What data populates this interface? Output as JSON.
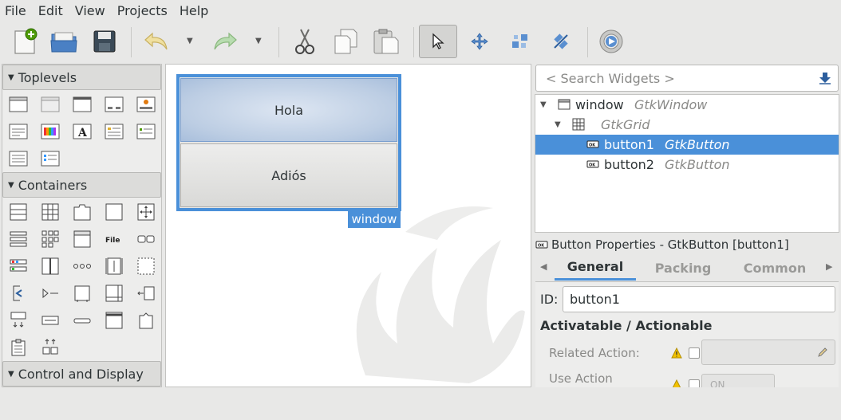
{
  "menu": {
    "file": "File",
    "edit": "Edit",
    "view": "View",
    "projects": "Projects",
    "help": "Help"
  },
  "toolbar": {
    "icons": [
      "new-file-icon",
      "open-folder-icon",
      "save-icon",
      "undo-icon",
      "redo-icon",
      "cut-icon",
      "copy-icon",
      "paste-icon",
      "pointer-icon",
      "move-icon",
      "resize-icon",
      "align-icon",
      "preview-icon"
    ]
  },
  "palette": {
    "toplevels": "Toplevels",
    "containers": "Containers",
    "control_display": "Control and Display"
  },
  "canvas": {
    "button1_label": "Hola",
    "button2_label": "Adiós",
    "window_tag": "window"
  },
  "inspector": {
    "search_placeholder": "< Search Widgets >",
    "tree": [
      {
        "name": "window",
        "type": "GtkWindow"
      },
      {
        "name": "",
        "type": "GtkGrid"
      },
      {
        "name": "button1",
        "type": "GtkButton"
      },
      {
        "name": "button2",
        "type": "GtkButton"
      }
    ],
    "props_title": "Button Properties - GtkButton [button1]",
    "tabs": [
      "General",
      "Packing",
      "Common"
    ],
    "id_label": "ID:",
    "id_value": "button1",
    "section_title": "Activatable / Actionable",
    "related_action": "Related Action:",
    "use_action": "Use Action",
    "toggle_on": "ON"
  },
  "colors": {
    "accent": "#4a90d9",
    "selection": "#4a90d9",
    "background": "#e8e8e7"
  }
}
